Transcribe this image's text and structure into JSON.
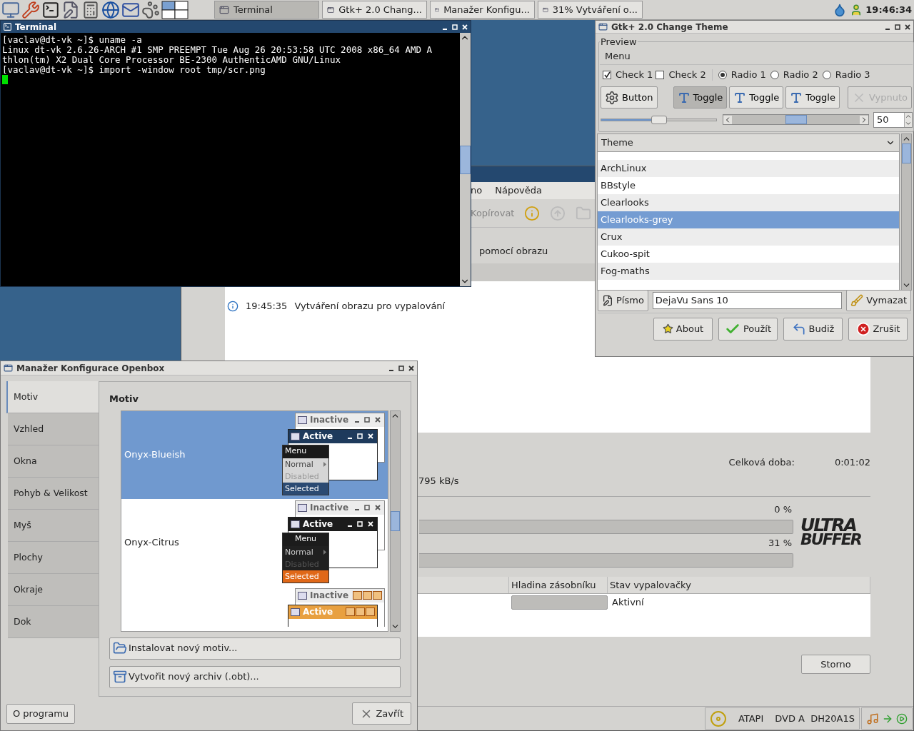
{
  "taskbar": {
    "tasks": [
      {
        "label": "Terminal",
        "selected": true
      },
      {
        "label": "Gtk+ 2.0 Chang...",
        "selected": false
      },
      {
        "label": "Manažer Konfigu...",
        "selected": false
      },
      {
        "label": "31% Vytváření o...",
        "selected": false
      }
    ],
    "clock": "19:46:34"
  },
  "terminal": {
    "title": "Terminal",
    "lines": [
      "[vaclav@dt-vk ~]$ uname -a",
      "Linux dt-vk 2.6.26-ARCH #1 SMP PREEMPT Tue Aug 26 20:53:58 UTC 2008 x86_64 AMD A",
      "thlon(tm) X2 Dual Core Processor BE-2300 AuthenticAMD GNU/Linux",
      "[vaclav@dt-vk ~]$ import -window root tmp/scr.png"
    ]
  },
  "burner": {
    "menu": [
      "no",
      "Nápověda"
    ],
    "toolbar": {
      "label": "Kopírovat",
      "disabled": true
    },
    "heading": "pomocí obrazu",
    "log": [
      {
        "time": "19:45:35",
        "text": "Vytváření obrazu pro vypalování"
      }
    ],
    "total_label": "Celková doba:",
    "total_value": "0:01:02",
    "speed": "795 kB/s",
    "progress": [
      {
        "reading": "0 %",
        "level": 0
      },
      {
        "reading": "31 %",
        "level": 0
      }
    ],
    "logo": [
      "ULTRA",
      "BUFFER"
    ],
    "table": {
      "columns": [
        "Hladina zásobníku",
        "Stav vypalovačky"
      ],
      "rows": [
        {
          "level": 0,
          "status": "Aktivní"
        }
      ]
    },
    "cancel": "Storno",
    "status_bar": {
      "drive": [
        "ATAPI",
        "DVD A  DH20A1S"
      ]
    }
  },
  "gtk": {
    "title": "Gtk+ 2.0 Change Theme",
    "frame": "Preview",
    "menu": "Menu",
    "checks": [
      {
        "label": "Check 1",
        "checked": true
      },
      {
        "label": "Check 2",
        "checked": false
      }
    ],
    "radios": [
      {
        "label": "Radio 1",
        "selected": true
      },
      {
        "label": "Radio 2",
        "selected": false
      },
      {
        "label": "Radio 3",
        "selected": false
      }
    ],
    "buttons": [
      {
        "kind": "button",
        "label": "Button",
        "disabled": false
      },
      {
        "kind": "toggle",
        "label": "Toggle",
        "on": true,
        "disabled": false
      },
      {
        "kind": "toggle",
        "label": "Toggle",
        "on": false,
        "disabled": false
      },
      {
        "kind": "toggle",
        "label": "Toggle",
        "on": false,
        "disabled": false
      },
      {
        "kind": "button",
        "label": "Vypnuto",
        "disabled": true
      }
    ],
    "slider": {
      "level": 0.5
    },
    "spin": "50",
    "theme_list": {
      "header": "Theme",
      "rows": [
        {
          "label": "ArchLinux",
          "selected": false
        },
        {
          "label": "BBstyle",
          "selected": false
        },
        {
          "label": "Clearlooks",
          "selected": false
        },
        {
          "label": "Clearlooks-grey",
          "selected": true
        },
        {
          "label": "Crux",
          "selected": false
        },
        {
          "label": "Cukoo-spit",
          "selected": false
        },
        {
          "label": "Fog-maths",
          "selected": false
        }
      ]
    },
    "font_button": "Písmo",
    "font_value": "DejaVu Sans 10",
    "clear": "Vymazat",
    "actions": [
      "About",
      "Použít",
      "Budiž",
      "Zrušit"
    ]
  },
  "openbox": {
    "title": "Manažer Konfigurace Openbox",
    "tabs": [
      {
        "label": "Motiv",
        "selected": true
      },
      {
        "label": "Vzhled",
        "selected": false
      },
      {
        "label": "Okna",
        "selected": false
      },
      {
        "label": "Pohyb & Velikost",
        "selected": false
      },
      {
        "label": "Myš",
        "selected": false
      },
      {
        "label": "Plochy",
        "selected": false
      },
      {
        "label": "Okraje",
        "selected": false
      },
      {
        "label": "Dok",
        "selected": false
      }
    ],
    "heading": "Motiv",
    "themes": [
      {
        "name": "Onyx-Blueish",
        "selected": true,
        "kind": "blueish",
        "preview": {
          "inactive": "Inactive",
          "active": "Active",
          "menu": "Menu",
          "normal": "Normal",
          "disabled": "Disabled",
          "selected": "Selected"
        }
      },
      {
        "name": "Onyx-Citrus",
        "selected": false,
        "kind": "citrus",
        "preview": {
          "inactive": "Inactive",
          "active": "Active",
          "menu": "Menu",
          "normal": "Normal",
          "disabled": "Disabled",
          "selected": "Selected"
        }
      },
      {
        "selected": false,
        "kind": "human",
        "preview": {
          "inactive": "Inactive",
          "active": "Active"
        }
      }
    ],
    "install": "Instalovat nový motiv...",
    "archive": "Vytvořit nový archiv (.obt)...",
    "about": "O programu",
    "close": "Zavřít"
  }
}
